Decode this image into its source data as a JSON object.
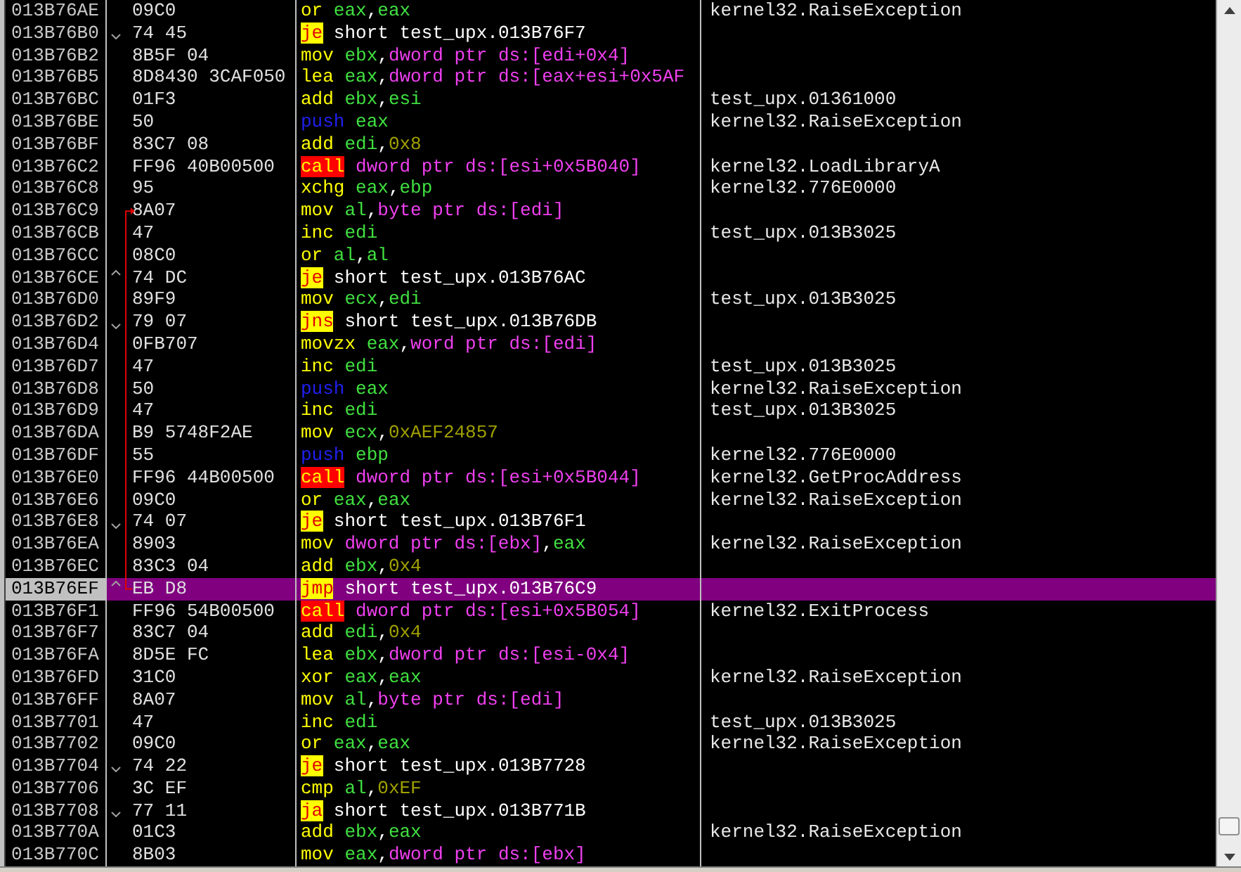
{
  "rows": [
    {
      "address": "013B76AE",
      "bytes": "09C0",
      "selected": false,
      "mnemonic": {
        "kind": "plain",
        "text": "or"
      },
      "operands": [
        {
          "kind": "reg",
          "text": "eax"
        },
        {
          "kind": "punct",
          "text": ","
        },
        {
          "kind": "reg",
          "text": "eax"
        }
      ],
      "comment": "kernel32.RaiseException"
    },
    {
      "address": "013B76B0",
      "bytes": "74 45",
      "selected": false,
      "jump_down": true,
      "mnemonic": {
        "kind": "jump",
        "text": "je"
      },
      "operands": [
        {
          "kind": "label",
          "text": "short test_upx.013B76F7"
        }
      ]
    },
    {
      "address": "013B76B2",
      "bytes": "8B5F 04",
      "selected": false,
      "mnemonic": {
        "kind": "plain",
        "text": "mov"
      },
      "operands": [
        {
          "kind": "reg",
          "text": "ebx"
        },
        {
          "kind": "punct",
          "text": ","
        },
        {
          "kind": "mem",
          "text": "dword ptr ds:[edi+0x4]"
        }
      ]
    },
    {
      "address": "013B76B5",
      "bytes": "8D8430 3CAF050",
      "selected": false,
      "mnemonic": {
        "kind": "plain",
        "text": "lea"
      },
      "operands": [
        {
          "kind": "reg",
          "text": "eax"
        },
        {
          "kind": "punct",
          "text": ","
        },
        {
          "kind": "mem",
          "text": "dword ptr ds:[eax+esi+0x5AF"
        }
      ]
    },
    {
      "address": "013B76BC",
      "bytes": "01F3",
      "selected": false,
      "mnemonic": {
        "kind": "plain",
        "text": "add"
      },
      "operands": [
        {
          "kind": "reg",
          "text": "ebx"
        },
        {
          "kind": "punct",
          "text": ","
        },
        {
          "kind": "reg",
          "text": "esi"
        }
      ],
      "comment": "test_upx.01361000"
    },
    {
      "address": "013B76BE",
      "bytes": "50",
      "selected": false,
      "mnemonic": {
        "kind": "push",
        "text": "push"
      },
      "operands": [
        {
          "kind": "reg",
          "text": "eax"
        }
      ],
      "comment": "kernel32.RaiseException"
    },
    {
      "address": "013B76BF",
      "bytes": "83C7 08",
      "selected": false,
      "mnemonic": {
        "kind": "plain",
        "text": "add"
      },
      "operands": [
        {
          "kind": "reg",
          "text": "edi"
        },
        {
          "kind": "punct",
          "text": ","
        },
        {
          "kind": "imm",
          "text": "0x8"
        }
      ]
    },
    {
      "address": "013B76C2",
      "bytes": "FF96 40B00500",
      "selected": false,
      "mnemonic": {
        "kind": "call",
        "text": "call"
      },
      "operands": [
        {
          "kind": "mem",
          "text": "dword ptr ds:[esi+0x5B040]"
        }
      ],
      "comment": "kernel32.LoadLibraryA"
    },
    {
      "address": "013B76C8",
      "bytes": "95",
      "selected": false,
      "mnemonic": {
        "kind": "plain",
        "text": "xchg"
      },
      "operands": [
        {
          "kind": "reg",
          "text": "eax"
        },
        {
          "kind": "punct",
          "text": ","
        },
        {
          "kind": "reg",
          "text": "ebp"
        }
      ],
      "comment": "kernel32.776E0000"
    },
    {
      "address": "013B76C9",
      "bytes": "8A07",
      "selected": false,
      "loop_target": true,
      "mnemonic": {
        "kind": "plain",
        "text": "mov"
      },
      "operands": [
        {
          "kind": "reg",
          "text": "al"
        },
        {
          "kind": "punct",
          "text": ","
        },
        {
          "kind": "mem",
          "text": "byte ptr ds:[edi]"
        }
      ]
    },
    {
      "address": "013B76CB",
      "bytes": "47",
      "selected": false,
      "mnemonic": {
        "kind": "plain",
        "text": "inc"
      },
      "operands": [
        {
          "kind": "reg",
          "text": "edi"
        }
      ],
      "comment": "test_upx.013B3025"
    },
    {
      "address": "013B76CC",
      "bytes": "08C0",
      "selected": false,
      "mnemonic": {
        "kind": "plain",
        "text": "or"
      },
      "operands": [
        {
          "kind": "reg",
          "text": "al"
        },
        {
          "kind": "punct",
          "text": ","
        },
        {
          "kind": "reg",
          "text": "al"
        }
      ]
    },
    {
      "address": "013B76CE",
      "bytes": "74 DC",
      "selected": false,
      "jump_up": true,
      "mnemonic": {
        "kind": "jump",
        "text": "je"
      },
      "operands": [
        {
          "kind": "label",
          "text": "short test_upx.013B76AC"
        }
      ]
    },
    {
      "address": "013B76D0",
      "bytes": "89F9",
      "selected": false,
      "mnemonic": {
        "kind": "plain",
        "text": "mov"
      },
      "operands": [
        {
          "kind": "reg",
          "text": "ecx"
        },
        {
          "kind": "punct",
          "text": ","
        },
        {
          "kind": "reg",
          "text": "edi"
        }
      ],
      "comment": "test_upx.013B3025"
    },
    {
      "address": "013B76D2",
      "bytes": "79 07",
      "selected": false,
      "jump_down": true,
      "mnemonic": {
        "kind": "jump",
        "text": "jns"
      },
      "operands": [
        {
          "kind": "label",
          "text": "short test_upx.013B76DB"
        }
      ]
    },
    {
      "address": "013B76D4",
      "bytes": "0FB707",
      "selected": false,
      "mnemonic": {
        "kind": "plain",
        "text": "movzx"
      },
      "operands": [
        {
          "kind": "reg",
          "text": "eax"
        },
        {
          "kind": "punct",
          "text": ","
        },
        {
          "kind": "mem",
          "text": "word ptr ds:[edi]"
        }
      ]
    },
    {
      "address": "013B76D7",
      "bytes": "47",
      "selected": false,
      "mnemonic": {
        "kind": "plain",
        "text": "inc"
      },
      "operands": [
        {
          "kind": "reg",
          "text": "edi"
        }
      ],
      "comment": "test_upx.013B3025"
    },
    {
      "address": "013B76D8",
      "bytes": "50",
      "selected": false,
      "mnemonic": {
        "kind": "push",
        "text": "push"
      },
      "operands": [
        {
          "kind": "reg",
          "text": "eax"
        }
      ],
      "comment": "kernel32.RaiseException"
    },
    {
      "address": "013B76D9",
      "bytes": "47",
      "selected": false,
      "mnemonic": {
        "kind": "plain",
        "text": "inc"
      },
      "operands": [
        {
          "kind": "reg",
          "text": "edi"
        }
      ],
      "comment": "test_upx.013B3025"
    },
    {
      "address": "013B76DA",
      "bytes": "B9 5748F2AE",
      "selected": false,
      "mnemonic": {
        "kind": "plain",
        "text": "mov"
      },
      "operands": [
        {
          "kind": "reg",
          "text": "ecx"
        },
        {
          "kind": "punct",
          "text": ","
        },
        {
          "kind": "imm",
          "text": "0xAEF24857"
        }
      ]
    },
    {
      "address": "013B76DF",
      "bytes": "55",
      "selected": false,
      "mnemonic": {
        "kind": "push",
        "text": "push"
      },
      "operands": [
        {
          "kind": "reg",
          "text": "ebp"
        }
      ],
      "comment": "kernel32.776E0000"
    },
    {
      "address": "013B76E0",
      "bytes": "FF96 44B00500",
      "selected": false,
      "mnemonic": {
        "kind": "call",
        "text": "call"
      },
      "operands": [
        {
          "kind": "mem",
          "text": "dword ptr ds:[esi+0x5B044]"
        }
      ],
      "comment": "kernel32.GetProcAddress"
    },
    {
      "address": "013B76E6",
      "bytes": "09C0",
      "selected": false,
      "mnemonic": {
        "kind": "plain",
        "text": "or"
      },
      "operands": [
        {
          "kind": "reg",
          "text": "eax"
        },
        {
          "kind": "punct",
          "text": ","
        },
        {
          "kind": "reg",
          "text": "eax"
        }
      ],
      "comment": "kernel32.RaiseException"
    },
    {
      "address": "013B76E8",
      "bytes": "74 07",
      "selected": false,
      "jump_down": true,
      "mnemonic": {
        "kind": "jump",
        "text": "je"
      },
      "operands": [
        {
          "kind": "label",
          "text": "short test_upx.013B76F1"
        }
      ]
    },
    {
      "address": "013B76EA",
      "bytes": "8903",
      "selected": false,
      "mnemonic": {
        "kind": "plain",
        "text": "mov"
      },
      "operands": [
        {
          "kind": "mem",
          "text": "dword ptr ds:[ebx]"
        },
        {
          "kind": "punct",
          "text": ","
        },
        {
          "kind": "reg",
          "text": "eax"
        }
      ],
      "comment": "kernel32.RaiseException"
    },
    {
      "address": "013B76EC",
      "bytes": "83C3 04",
      "selected": false,
      "mnemonic": {
        "kind": "plain",
        "text": "add"
      },
      "operands": [
        {
          "kind": "reg",
          "text": "ebx"
        },
        {
          "kind": "punct",
          "text": ","
        },
        {
          "kind": "imm",
          "text": "0x4"
        }
      ]
    },
    {
      "address": "013B76EF",
      "bytes": "EB D8",
      "selected": true,
      "jump_up": true,
      "loop_source": true,
      "mnemonic": {
        "kind": "jump",
        "text": "jmp"
      },
      "operands": [
        {
          "kind": "label",
          "text": "short test_upx.013B76C9"
        }
      ]
    },
    {
      "address": "013B76F1",
      "bytes": "FF96 54B00500",
      "selected": false,
      "mnemonic": {
        "kind": "call",
        "text": "call"
      },
      "operands": [
        {
          "kind": "mem",
          "text": "dword ptr ds:[esi+0x5B054]"
        }
      ],
      "comment": "kernel32.ExitProcess"
    },
    {
      "address": "013B76F7",
      "bytes": "83C7 04",
      "selected": false,
      "mnemonic": {
        "kind": "plain",
        "text": "add"
      },
      "operands": [
        {
          "kind": "reg",
          "text": "edi"
        },
        {
          "kind": "punct",
          "text": ","
        },
        {
          "kind": "imm",
          "text": "0x4"
        }
      ]
    },
    {
      "address": "013B76FA",
      "bytes": "8D5E FC",
      "selected": false,
      "mnemonic": {
        "kind": "plain",
        "text": "lea"
      },
      "operands": [
        {
          "kind": "reg",
          "text": "ebx"
        },
        {
          "kind": "punct",
          "text": ","
        },
        {
          "kind": "mem",
          "text": "dword ptr ds:[esi-0x4]"
        }
      ]
    },
    {
      "address": "013B76FD",
      "bytes": "31C0",
      "selected": false,
      "mnemonic": {
        "kind": "plain",
        "text": "xor"
      },
      "operands": [
        {
          "kind": "reg",
          "text": "eax"
        },
        {
          "kind": "punct",
          "text": ","
        },
        {
          "kind": "reg",
          "text": "eax"
        }
      ],
      "comment": "kernel32.RaiseException"
    },
    {
      "address": "013B76FF",
      "bytes": "8A07",
      "selected": false,
      "mnemonic": {
        "kind": "plain",
        "text": "mov"
      },
      "operands": [
        {
          "kind": "reg",
          "text": "al"
        },
        {
          "kind": "punct",
          "text": ","
        },
        {
          "kind": "mem",
          "text": "byte ptr ds:[edi]"
        }
      ]
    },
    {
      "address": "013B7701",
      "bytes": "47",
      "selected": false,
      "mnemonic": {
        "kind": "plain",
        "text": "inc"
      },
      "operands": [
        {
          "kind": "reg",
          "text": "edi"
        }
      ],
      "comment": "test_upx.013B3025"
    },
    {
      "address": "013B7702",
      "bytes": "09C0",
      "selected": false,
      "mnemonic": {
        "kind": "plain",
        "text": "or"
      },
      "operands": [
        {
          "kind": "reg",
          "text": "eax"
        },
        {
          "kind": "punct",
          "text": ","
        },
        {
          "kind": "reg",
          "text": "eax"
        }
      ],
      "comment": "kernel32.RaiseException"
    },
    {
      "address": "013B7704",
      "bytes": "74 22",
      "selected": false,
      "jump_down": true,
      "mnemonic": {
        "kind": "jump",
        "text": "je"
      },
      "operands": [
        {
          "kind": "label",
          "text": "short test_upx.013B7728"
        }
      ]
    },
    {
      "address": "013B7706",
      "bytes": "3C EF",
      "selected": false,
      "mnemonic": {
        "kind": "plain",
        "text": "cmp"
      },
      "operands": [
        {
          "kind": "reg",
          "text": "al"
        },
        {
          "kind": "punct",
          "text": ","
        },
        {
          "kind": "imm",
          "text": "0xEF"
        }
      ]
    },
    {
      "address": "013B7708",
      "bytes": "77 11",
      "selected": false,
      "jump_down": true,
      "mnemonic": {
        "kind": "jump",
        "text": "ja"
      },
      "operands": [
        {
          "kind": "label",
          "text": "short test_upx.013B771B"
        }
      ]
    },
    {
      "address": "013B770A",
      "bytes": "01C3",
      "selected": false,
      "mnemonic": {
        "kind": "plain",
        "text": "add"
      },
      "operands": [
        {
          "kind": "reg",
          "text": "ebx"
        },
        {
          "kind": "punct",
          "text": ","
        },
        {
          "kind": "reg",
          "text": "eax"
        }
      ],
      "comment": "kernel32.RaiseException"
    },
    {
      "address": "013B770C",
      "bytes": "8B03",
      "selected": false,
      "mnemonic": {
        "kind": "plain",
        "text": "mov"
      },
      "operands": [
        {
          "kind": "reg",
          "text": "eax"
        },
        {
          "kind": "punct",
          "text": ","
        },
        {
          "kind": "mem",
          "text": "dword ptr ds:[ebx]"
        }
      ]
    }
  ]
}
